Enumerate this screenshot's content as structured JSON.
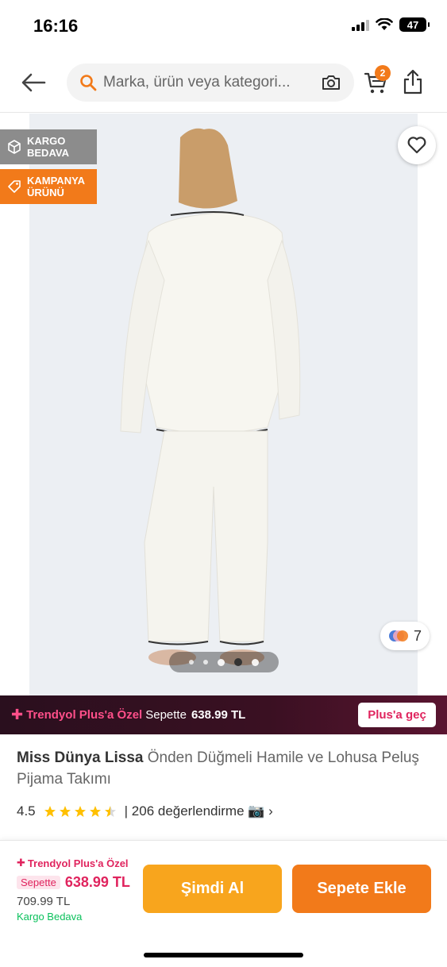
{
  "status_bar": {
    "time": "16:16",
    "battery": "47"
  },
  "header": {
    "search_placeholder": "Marka, ürün veya kategori...",
    "cart_count": "2"
  },
  "badges": {
    "kargo": "KARGO BEDAVA",
    "kampanya": "KAMPANYA ÜRÜNÜ"
  },
  "gallery": {
    "color_count": "7",
    "image_count": 5,
    "active_index": 3
  },
  "plus_bar": {
    "title": "Trendyol Plus'a Özel",
    "sepette": "Sepette",
    "price": "638.99 TL",
    "button": "Plus'a geç"
  },
  "product": {
    "brand": "Miss Dünya Lissa",
    "name": "Önden Düğmeli Hamile ve Lohusa Peluş Pijama Takımı",
    "rating": "4.5",
    "rating_stars": 4.5,
    "reviews": "| 206 değerlendirme 📷 ›"
  },
  "bottom_bar": {
    "plus_title": "Trendyol Plus'a Özel",
    "sepette": "Sepette",
    "price": "638.99 TL",
    "old_price": "709.99 TL",
    "shipping": "Kargo Bedava",
    "buy_now": "Şimdi Al",
    "add_to_cart": "Sepete Ekle"
  },
  "colors": {
    "accent": "#f27a1a",
    "plus_pink": "#e0245e",
    "buy_yellow": "#f8a51d",
    "shipping_green": "#0bc15c"
  }
}
